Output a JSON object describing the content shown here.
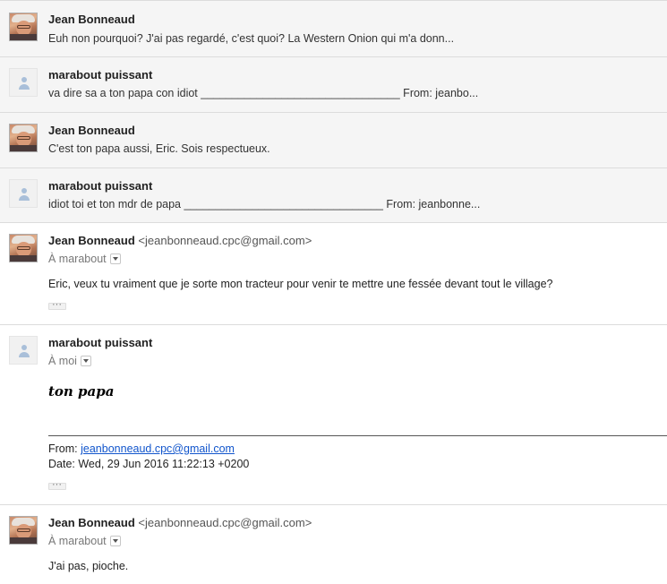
{
  "messages": [
    {
      "sender": "Jean Bonneaud",
      "snippet": "Euh non pourquoi? J'ai pas regardé, c'est quoi? La Western Onion qui m'a donn..."
    },
    {
      "sender": "marabout puissant",
      "snippet": "va dire sa a ton papa con idiot ________________________________ From: jeanbo..."
    },
    {
      "sender": "Jean Bonneaud",
      "snippet": "C'est ton papa aussi, Eric. Sois respectueux."
    },
    {
      "sender": "marabout puissant",
      "snippet": "idiot toi et ton mdr de papa ________________________________ From: jeanbonne..."
    },
    {
      "sender": "Jean Bonneaud",
      "email": "<jeanbonneaud.cpc@gmail.com>",
      "to": "À marabout",
      "body": "Eric, veux tu vraiment que je sorte mon tracteur pour venir te mettre une fessée devant tout le village?"
    },
    {
      "sender": "marabout puissant",
      "to": "À moi",
      "body": "ton papa",
      "from_label": "From:",
      "from_email": "jeanbonneaud.cpc@gmail.com",
      "date_line": "Date: Wed, 29 Jun 2016 11:22:13 +0200"
    },
    {
      "sender": "Jean Bonneaud",
      "email": "<jeanbonneaud.cpc@gmail.com>",
      "to": "À marabout",
      "body": "J'ai pas, pioche."
    }
  ]
}
